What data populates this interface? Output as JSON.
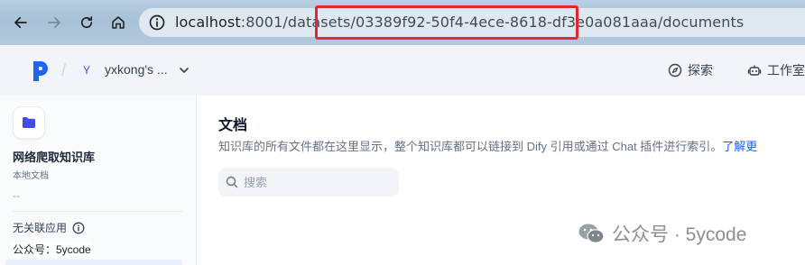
{
  "browser": {
    "url_host": "localhost",
    "url_rest": ":8001/datasets/03389f92-50f4-4ece-8618-df3e0a081aaa/documents"
  },
  "header": {
    "workspace_initial": "Y",
    "workspace_name": "yxkong's ...",
    "explore_label": "探索",
    "studio_label": "工作室"
  },
  "sidebar": {
    "dataset_name": "网络爬取知识库",
    "dataset_type": "本地文档",
    "dataset_desc": "--",
    "no_app_label": "无关联应用"
  },
  "main": {
    "title": "文档",
    "description": "知识库的所有文件都在这里显示，整个知识库都可以链接到 Dify 引用或通过 Chat 插件进行索引。",
    "learn_more": "了解更",
    "search_placeholder": "搜索"
  },
  "watermark": {
    "right_text": "公众号 · 5ycode",
    "left_text": "公众号：5ycode"
  },
  "colors": {
    "highlight": "#e5262b",
    "accent": "#155eef"
  }
}
